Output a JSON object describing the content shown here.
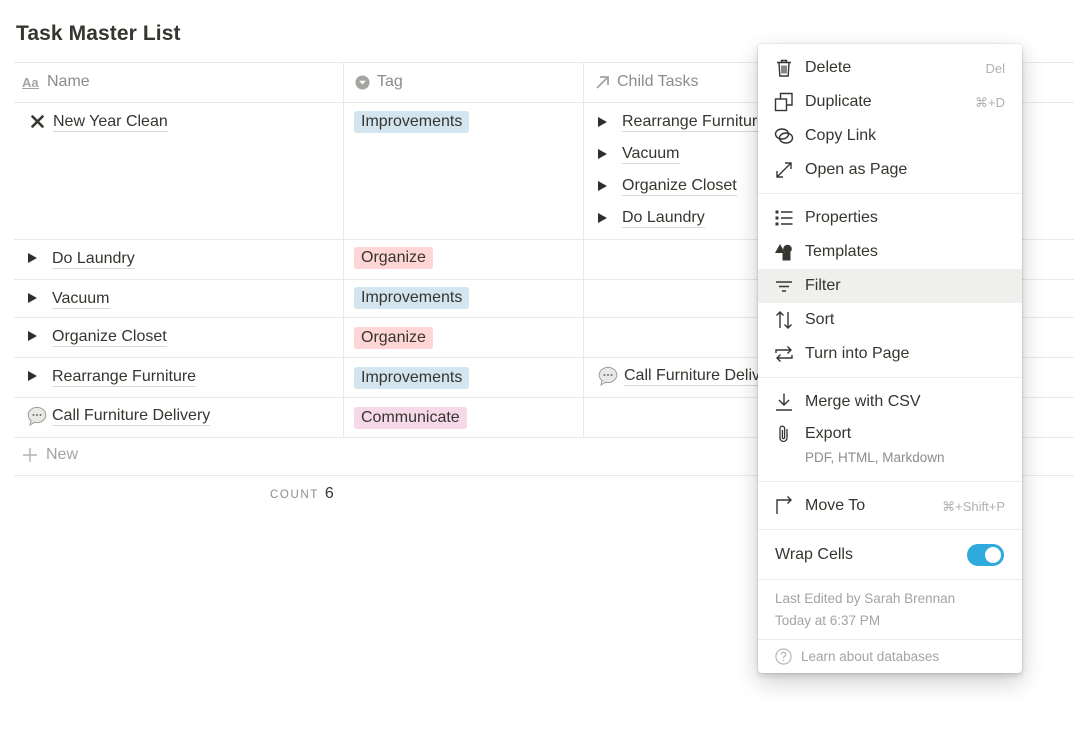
{
  "page": {
    "title": "Task Master List"
  },
  "columns": {
    "name": "Name",
    "tag": "Tag",
    "child": "Child Tasks"
  },
  "rows": [
    {
      "name": "New Year Clean",
      "tag": "Improvements",
      "children": [
        "Rearrange Furniture",
        "Vacuum",
        "Organize Closet",
        "Do Laundry"
      ]
    },
    {
      "name": "Do Laundry",
      "tag": "Organize"
    },
    {
      "name": "Vacuum",
      "tag": "Improvements"
    },
    {
      "name": "Organize Closet",
      "tag": "Organize"
    },
    {
      "name": "Rearrange Furniture",
      "tag": "Improvements",
      "children": [
        "Call Furniture Delivery"
      ]
    },
    {
      "name": "Call Furniture Delivery",
      "tag": "Communicate"
    }
  ],
  "new_row": {
    "label": "New"
  },
  "footer": {
    "count_label": "COUNT",
    "count_value": "6"
  },
  "menu": {
    "items": [
      {
        "label": "Delete",
        "shortcut": "Del"
      },
      {
        "label": "Duplicate",
        "shortcut": "⌘+D"
      },
      {
        "label": "Copy Link"
      },
      {
        "label": "Open as Page"
      },
      {
        "label": "Properties"
      },
      {
        "label": "Templates"
      },
      {
        "label": "Filter"
      },
      {
        "label": "Sort"
      },
      {
        "label": "Turn into Page"
      },
      {
        "label": "Merge with CSV"
      },
      {
        "label": "Export",
        "sub": "PDF, HTML, Markdown"
      },
      {
        "label": "Move To",
        "shortcut": "⌘+Shift+P"
      }
    ],
    "wrap_cells": {
      "label": "Wrap Cells",
      "on": true
    },
    "last_edited": {
      "line1": "Last Edited by Sarah Brennan",
      "line2": "Today at 6:37 PM"
    },
    "learn": "Learn about databases"
  },
  "colors": {
    "tag_improvements": "#d3e5ef",
    "tag_organize": "#ffd6d5",
    "tag_communicate": "#f5d9e9",
    "toggle_on": "#2eaadc",
    "hover_row": "#efefee"
  },
  "icons": {
    "name_column": "text-aa-icon",
    "tag_column": "select-chevron-icon",
    "child_column": "relation-arrow-icon",
    "row_expand": "triangle-right-icon",
    "page_new_year": "x-mark-icon",
    "page_call": "speech-bubble-icon"
  }
}
